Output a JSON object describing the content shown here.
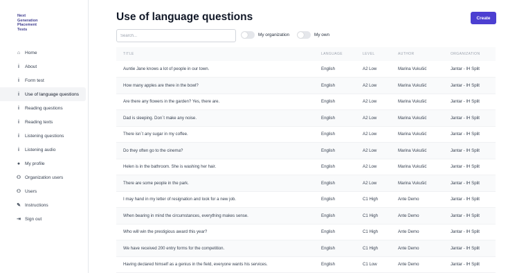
{
  "logo": [
    "Next",
    "Generation",
    "Placement",
    "Tests"
  ],
  "nav": [
    {
      "label": "Home",
      "icon": "⌂",
      "name": "home"
    },
    {
      "label": "About",
      "icon": "i",
      "name": "about"
    },
    {
      "label": "Form test",
      "icon": "i",
      "name": "form-test"
    },
    {
      "label": "Use of language questions",
      "icon": "i",
      "name": "use-of-language-questions",
      "active": true
    },
    {
      "label": "Reading questions",
      "icon": "i",
      "name": "reading-questions"
    },
    {
      "label": "Reading texts",
      "icon": "i",
      "name": "reading-texts"
    },
    {
      "label": "Listening questions",
      "icon": "i",
      "name": "listening-questions"
    },
    {
      "label": "Listening audio",
      "icon": "i",
      "name": "listening-audio"
    },
    {
      "label": "My profile",
      "icon": "●",
      "name": "my-profile"
    },
    {
      "label": "Organization users",
      "icon": "⚇",
      "name": "organization-users"
    },
    {
      "label": "Users",
      "icon": "⚇",
      "name": "users"
    },
    {
      "label": "Instructions",
      "icon": "✎",
      "name": "instructions"
    },
    {
      "label": "Sign out",
      "icon": "⇥",
      "name": "sign-out"
    }
  ],
  "page": {
    "title": "Use of language questions",
    "create_label": "Create",
    "search_placeholder": "Search...",
    "toggle_my_org": "My organization",
    "toggle_my_own": "My own"
  },
  "table": {
    "headers": [
      "TITLE",
      "LANGUAGE",
      "LEVEL",
      "AUTHOR",
      "ORGANIZATION"
    ],
    "rows": [
      [
        "Auntie Jane knows a lot of people in our town.",
        "English",
        "A2 Low",
        "Marina Vukušić",
        "Jantar - IH Split"
      ],
      [
        "How many apples are there in the bowl?",
        "English",
        "A2 Low",
        "Marina Vukušić",
        "Jantar - IH Split"
      ],
      [
        "Are there any flowers in the garden? Yes, there are.",
        "English",
        "A2 Low",
        "Marina Vukušić",
        "Jantar - IH Split"
      ],
      [
        "Dad is sleeping. Don´t make any noise.",
        "English",
        "A2 Low",
        "Marina Vukušić",
        "Jantar - IH Split"
      ],
      [
        "There isn´t any sugar in my coffee.",
        "English",
        "A2 Low",
        "Marina Vukušić",
        "Jantar - IH Split"
      ],
      [
        "Do they often go to the cinema?",
        "English",
        "A2 Low",
        "Marina Vukušić",
        "Jantar - IH Split"
      ],
      [
        "Helen is in the bathroom. She is washing her hair.",
        "English",
        "A2 Low",
        "Marina Vukušić",
        "Jantar - IH Split"
      ],
      [
        "There are some people in the park.",
        "English",
        "A2 Low",
        "Marina Vukušić",
        "Jantar - IH Split"
      ],
      [
        "I may hand in my letter of resignation and look for a new job.",
        "English",
        "C1 High",
        "Ante Demo",
        "Jantar - IH Split"
      ],
      [
        "When bearing in mind the circumstances, everything makes sense.",
        "English",
        "C1 High",
        "Ante Demo",
        "Jantar - IH Split"
      ],
      [
        "Who will win the prestigious award this year?",
        "English",
        "C1 High",
        "Ante Demo",
        "Jantar - IH Split"
      ],
      [
        "We have received 200 entry forms for the competition.",
        "English",
        "C1 High",
        "Ante Demo",
        "Jantar - IH Split"
      ],
      [
        "Having declared himself as a genius in the field, everyone wants his services.",
        "English",
        "C1 Low",
        "Ante Demo",
        "Jantar - IH Split"
      ]
    ]
  }
}
